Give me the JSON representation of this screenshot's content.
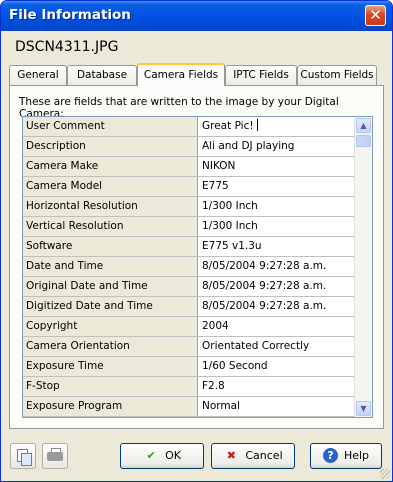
{
  "window": {
    "title": "File Information",
    "close_label": "✕"
  },
  "filename": "DSCN4311.JPG",
  "tabs": [
    {
      "label": "General"
    },
    {
      "label": "Database"
    },
    {
      "label": "Camera Fields",
      "active": true
    },
    {
      "label": "IPTC Fields"
    },
    {
      "label": "Custom Fields"
    }
  ],
  "panel": {
    "description": "These are fields that are written to the image by your Digital Camera:"
  },
  "fields": [
    {
      "key": "User Comment",
      "value": "Great Pic!"
    },
    {
      "key": "Description",
      "value": "Ali and DJ playing"
    },
    {
      "key": "Camera Make",
      "value": "NIKON"
    },
    {
      "key": "Camera Model",
      "value": "E775"
    },
    {
      "key": "Horizontal Resolution",
      "value": "1/300 Inch"
    },
    {
      "key": "Vertical Resolution",
      "value": "1/300 Inch"
    },
    {
      "key": "Software",
      "value": "E775 v1.3u"
    },
    {
      "key": "Date and Time",
      "value": "8/05/2004 9:27:28 a.m."
    },
    {
      "key": "Original Date and Time",
      "value": "8/05/2004 9:27:28 a.m."
    },
    {
      "key": "Digitized Date and Time",
      "value": "8/05/2004 9:27:28 a.m."
    },
    {
      "key": "Copyright",
      "value": "2004"
    },
    {
      "key": "Camera Orientation",
      "value": "Orientated Correctly"
    },
    {
      "key": "Exposure Time",
      "value": "1/60 Second"
    },
    {
      "key": "F-Stop",
      "value": "F2.8"
    },
    {
      "key": "Exposure Program",
      "value": "Normal"
    }
  ],
  "scrollbar": {
    "up_glyph": "▲",
    "down_glyph": "▼"
  },
  "buttons": {
    "ok": {
      "label": "OK",
      "icon": "check-icon",
      "glyph": "✔"
    },
    "cancel": {
      "label": "Cancel",
      "icon": "x-icon",
      "glyph": "✖"
    },
    "help": {
      "label": "Help",
      "icon": "help-icon",
      "glyph": "?"
    }
  },
  "colors": {
    "accent": "#0054e3",
    "ok_icon": "#2f9a2f",
    "cancel_icon": "#d01818",
    "help_icon": "#2a62c9",
    "tab_highlight": "#ffc83c"
  }
}
